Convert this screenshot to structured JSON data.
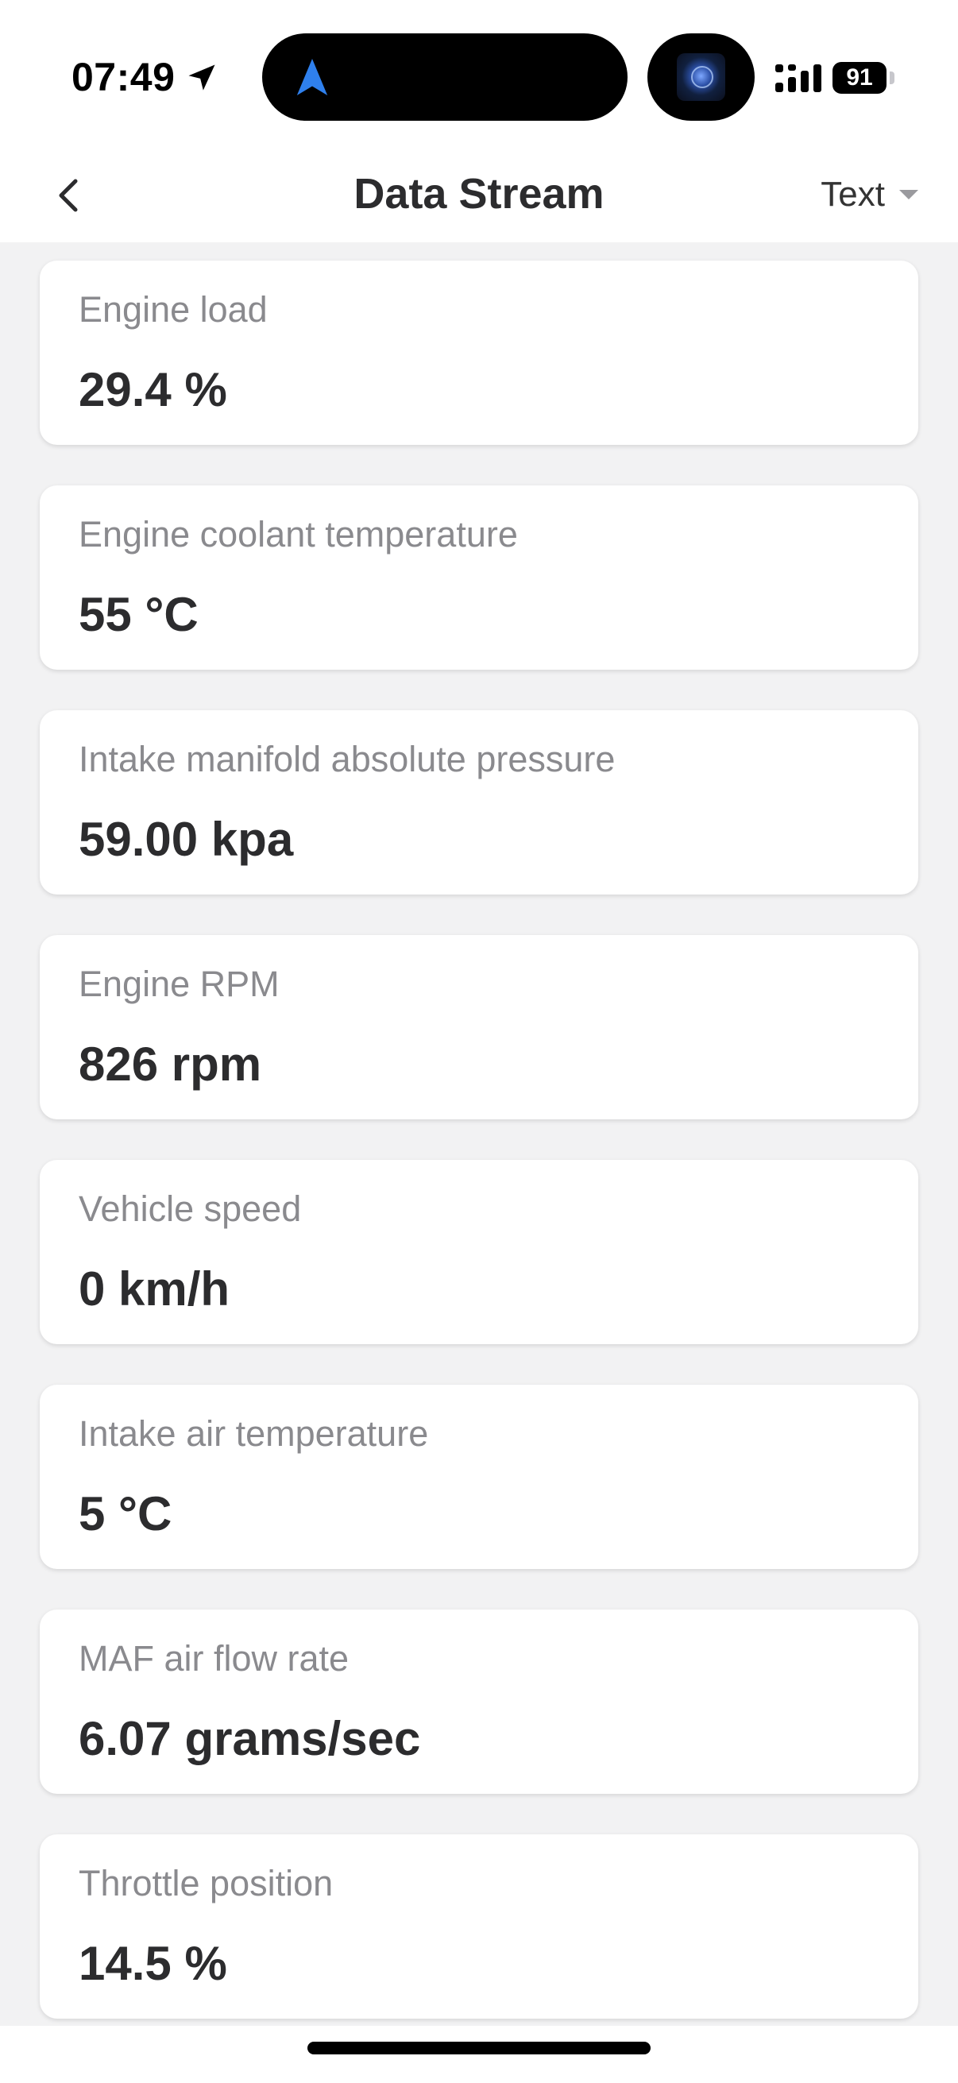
{
  "status_bar": {
    "time": "07:49",
    "location_icon": "location-arrow-icon",
    "navigation_icon": "navigation-arrow-icon",
    "signal_icon": "cellular-signal-icon",
    "battery_level": "91",
    "accent_color": "#2f80ed"
  },
  "nav": {
    "title": "Data Stream",
    "back_icon": "chevron-left-icon",
    "view_mode": "Text",
    "dropdown_icon": "caret-down-icon"
  },
  "items": [
    {
      "label": "Engine load",
      "value": "29.4 %"
    },
    {
      "label": "Engine coolant temperature",
      "value": "55 °C"
    },
    {
      "label": "Intake manifold absolute pressure",
      "value": "59.00 kpa"
    },
    {
      "label": "Engine RPM",
      "value": "826 rpm"
    },
    {
      "label": "Vehicle speed",
      "value": "0 km/h"
    },
    {
      "label": "Intake air temperature",
      "value": "5 °C"
    },
    {
      "label": "MAF air flow rate",
      "value": "6.07 grams/sec"
    },
    {
      "label": "Throttle position",
      "value": "14.5 %"
    }
  ]
}
